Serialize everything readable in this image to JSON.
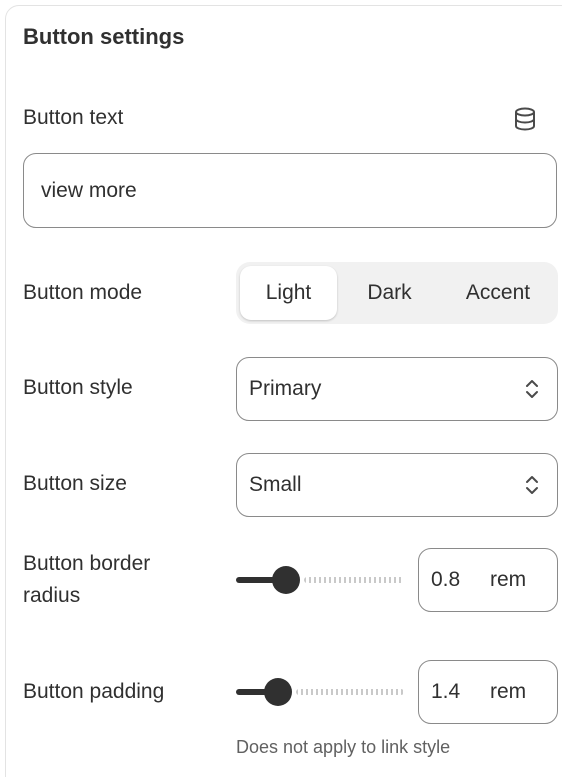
{
  "panel": {
    "title": "Button settings"
  },
  "button_text": {
    "label": "Button text",
    "value": "view more",
    "icon": "database-icon"
  },
  "button_mode": {
    "label": "Button mode",
    "options": [
      "Light",
      "Dark",
      "Accent"
    ],
    "selected": "Light"
  },
  "button_style": {
    "label": "Button style",
    "value": "Primary",
    "icon": "select-arrows-icon"
  },
  "button_size": {
    "label": "Button size",
    "value": "Small",
    "icon": "select-arrows-icon"
  },
  "border_radius": {
    "label_line1": "Button border",
    "label_line2": "radius",
    "value": "0.8",
    "unit": "rem",
    "slider_fraction": 0.26
  },
  "padding": {
    "label": "Button padding",
    "value": "1.4",
    "unit": "rem",
    "slider_fraction": 0.2,
    "help": "Does not apply to link style"
  },
  "colors": {
    "text": "#303030",
    "border": "#8a8a8a",
    "muted": "#616161",
    "segment_bg": "#f1f1f1"
  }
}
